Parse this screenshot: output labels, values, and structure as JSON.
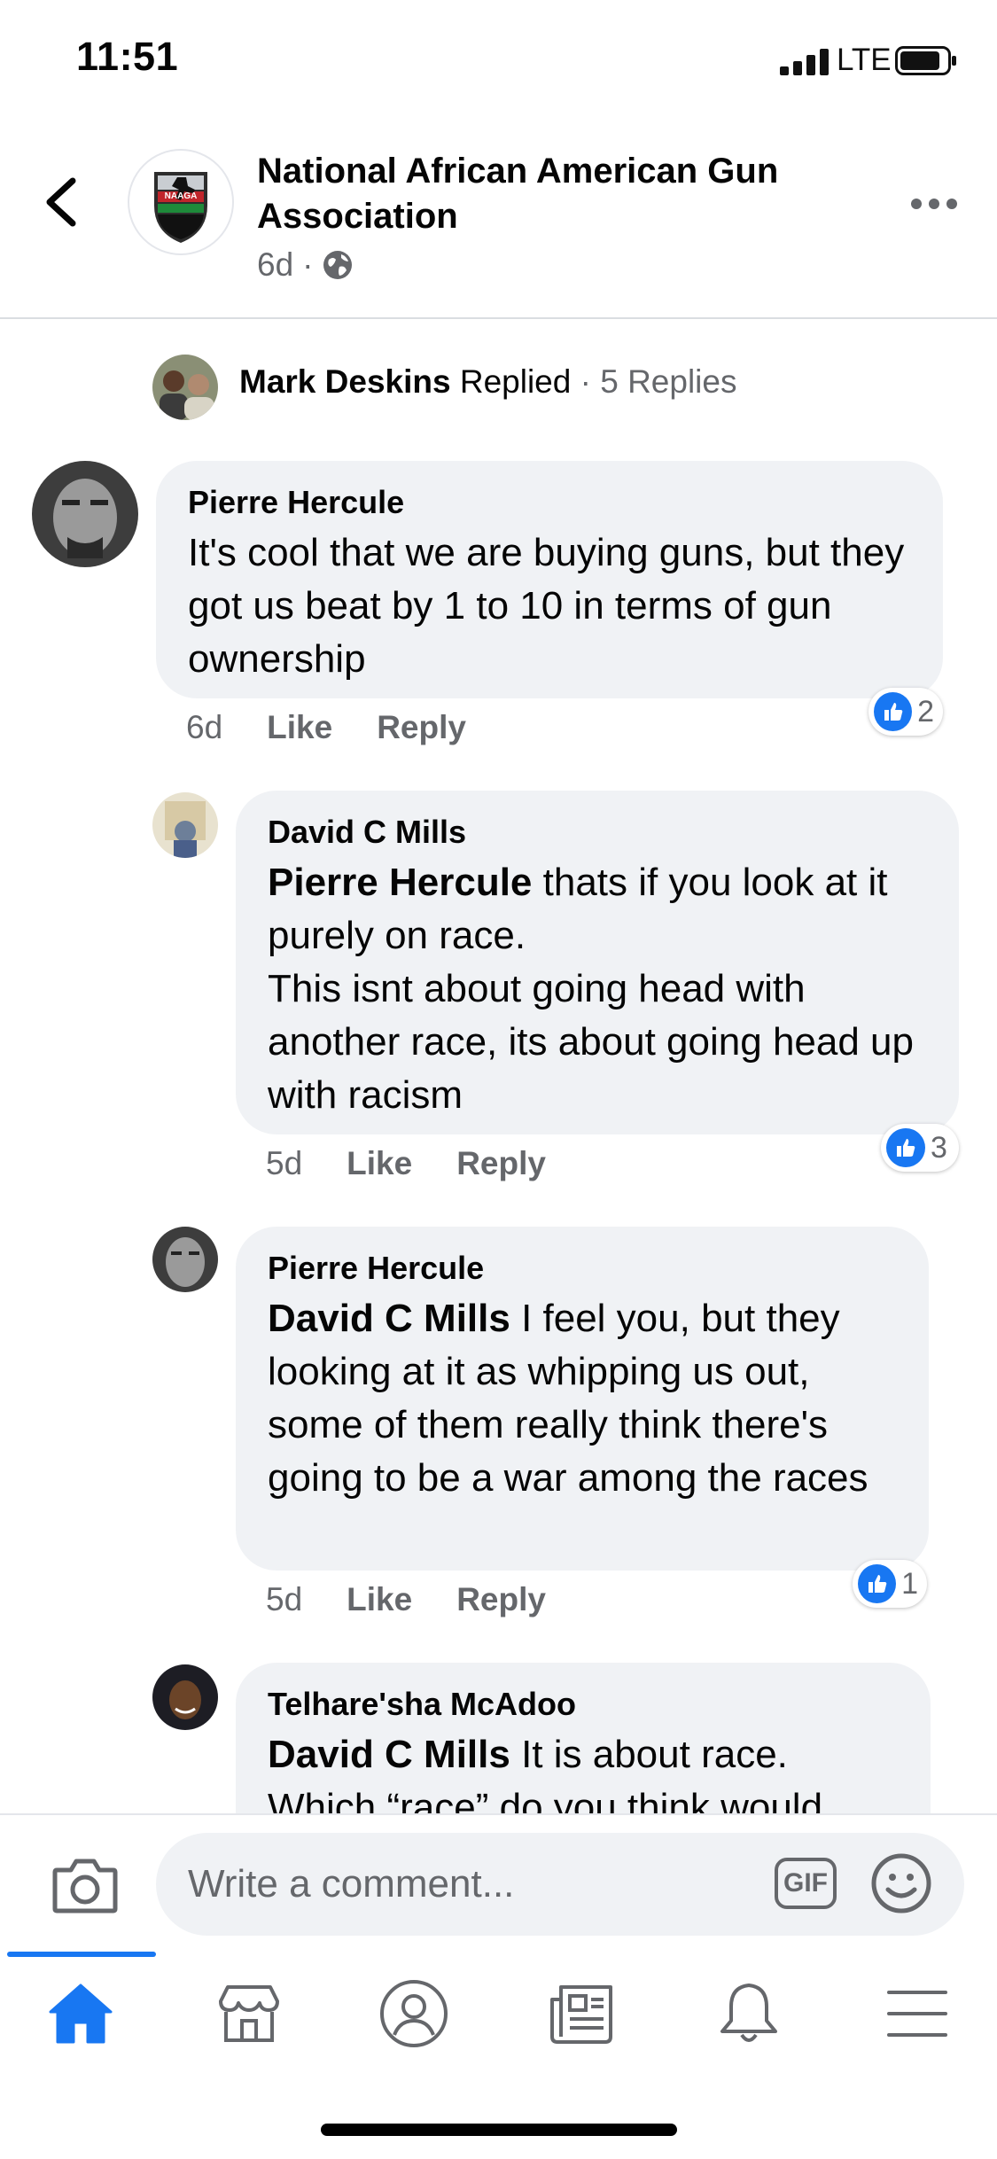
{
  "status_bar": {
    "time": "11:51",
    "network": "LTE"
  },
  "header": {
    "page_name": "National African American Gun Association",
    "age": "6d",
    "separator": "·",
    "privacy_icon": "globe-icon",
    "avatar_logo_text": "NAAGA"
  },
  "replied_summary": {
    "name": "Mark Deskins",
    "action": " Replied",
    "meta": " · 5 Replies"
  },
  "comments": [
    {
      "author": "Pierre Hercule",
      "mention": "",
      "text": "It's cool that we are buying guns, but they got us beat by 1 to 10 in terms of gun ownership",
      "time": "6d",
      "like_label": "Like",
      "reply_label": "Reply",
      "reactions": "2"
    },
    {
      "author": "David C Mills",
      "mention": "Pierre Hercule",
      "text": " thats if you look at it purely on race.\nThis isnt about going head with another race, its about going head up with racism",
      "time": "5d",
      "like_label": "Like",
      "reply_label": "Reply",
      "reactions": "3"
    },
    {
      "author": "Pierre Hercule",
      "mention": "David C Mills",
      "text": " I feel you, but they looking at it as whipping us out, some of them really think there's going to be a war  among the races",
      "time": "5d",
      "like_label": "Like",
      "reply_label": "Reply",
      "reactions": "1"
    },
    {
      "author": "Telhare'sha McAdoo",
      "mention": "David C Mills",
      "text": " It is about race.\nWhich “race” do you think would"
    }
  ],
  "composer": {
    "placeholder": "Write a comment...",
    "gif_label": "GIF",
    "camera_icon": "camera-icon",
    "emoji_icon": "smiley-icon"
  },
  "tab_bar": {
    "active": "home",
    "tabs": [
      "home-icon",
      "marketplace-icon",
      "profile-icon",
      "news-icon",
      "bell-icon",
      "menu-icon"
    ]
  },
  "colors": {
    "accent": "#1877f2",
    "bubble": "#f0f2f5",
    "secondary_text": "#65676b"
  }
}
